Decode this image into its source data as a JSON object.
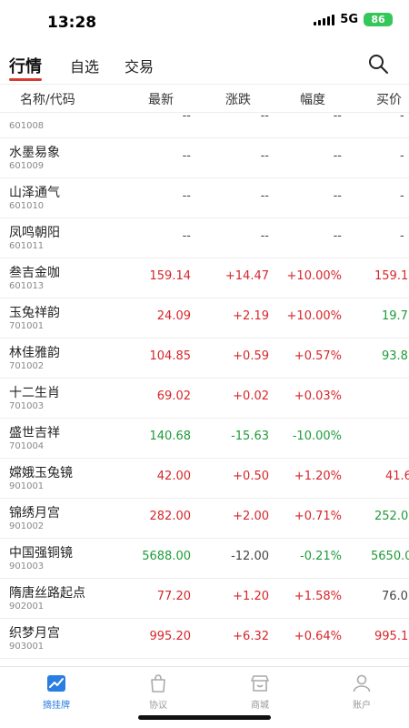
{
  "status": {
    "time": "13:28",
    "network": "5G",
    "battery": "86"
  },
  "tabs": [
    {
      "label": "行情",
      "active": true
    },
    {
      "label": "自选",
      "active": false
    },
    {
      "label": "交易",
      "active": false
    }
  ],
  "columns": {
    "name": "名称/代码",
    "last": "最新",
    "change": "涨跌",
    "pct": "幅度",
    "bid": "买价"
  },
  "rows": [
    {
      "name": "",
      "code": "601008",
      "last": "--",
      "change": "--",
      "pct": "--",
      "bid": "-",
      "trend": "flat"
    },
    {
      "name": "水墨易象",
      "code": "601009",
      "last": "--",
      "change": "--",
      "pct": "--",
      "bid": "-",
      "trend": "flat"
    },
    {
      "name": "山泽通气",
      "code": "601010",
      "last": "--",
      "change": "--",
      "pct": "--",
      "bid": "-",
      "trend": "flat"
    },
    {
      "name": "凤鸣朝阳",
      "code": "601011",
      "last": "--",
      "change": "--",
      "pct": "--",
      "bid": "-",
      "trend": "flat"
    },
    {
      "name": "叁吉金咖",
      "code": "601013",
      "last": "159.14",
      "change": "+14.47",
      "pct": "+10.00%",
      "bid": "159.1",
      "trend": "up"
    },
    {
      "name": "玉兔祥韵",
      "code": "701001",
      "last": "24.09",
      "change": "+2.19",
      "pct": "+10.00%",
      "bid": "19.7",
      "trend": "up",
      "bid_trend": "down"
    },
    {
      "name": "林佳雅韵",
      "code": "701002",
      "last": "104.85",
      "change": "+0.59",
      "pct": "+0.57%",
      "bid": "93.8",
      "trend": "up",
      "bid_trend": "down"
    },
    {
      "name": "十二生肖",
      "code": "701003",
      "last": "69.02",
      "change": "+0.02",
      "pct": "+0.03%",
      "bid": "",
      "trend": "up"
    },
    {
      "name": "盛世吉祥",
      "code": "701004",
      "last": "140.68",
      "change": "-15.63",
      "pct": "-10.00%",
      "bid": "",
      "trend": "down"
    },
    {
      "name": "嫦娥玉兔镜",
      "code": "901001",
      "last": "42.00",
      "change": "+0.50",
      "pct": "+1.20%",
      "bid": "41.6",
      "trend": "up"
    },
    {
      "name": "锦绣月宫",
      "code": "901002",
      "last": "282.00",
      "change": "+2.00",
      "pct": "+0.71%",
      "bid": "252.0",
      "trend": "up",
      "bid_trend": "down"
    },
    {
      "name": "中国强铜镜",
      "code": "901003",
      "last": "5688.00",
      "change": "-12.00",
      "pct": "-0.21%",
      "bid": "5650.0",
      "trend": "down"
    },
    {
      "name": "隋唐丝路起点",
      "code": "902001",
      "last": "77.20",
      "change": "+1.20",
      "pct": "+1.58%",
      "bid": "76.0",
      "trend": "up",
      "bid_trend": "flat"
    },
    {
      "name": "织梦月宫",
      "code": "903001",
      "last": "995.20",
      "change": "+6.32",
      "pct": "+0.64%",
      "bid": "995.1",
      "trend": "up"
    }
  ],
  "bottom_nav": [
    {
      "label": "摘挂牌",
      "icon": "chart-trend-icon",
      "active": true
    },
    {
      "label": "协议",
      "icon": "bag-icon",
      "active": false
    },
    {
      "label": "商城",
      "icon": "store-icon",
      "active": false
    },
    {
      "label": "账户",
      "icon": "user-icon",
      "active": false
    }
  ],
  "colors": {
    "up": "#d6262b",
    "down": "#1e9b3a",
    "accent": "#d93a30",
    "nav_active": "#2a7de1"
  }
}
